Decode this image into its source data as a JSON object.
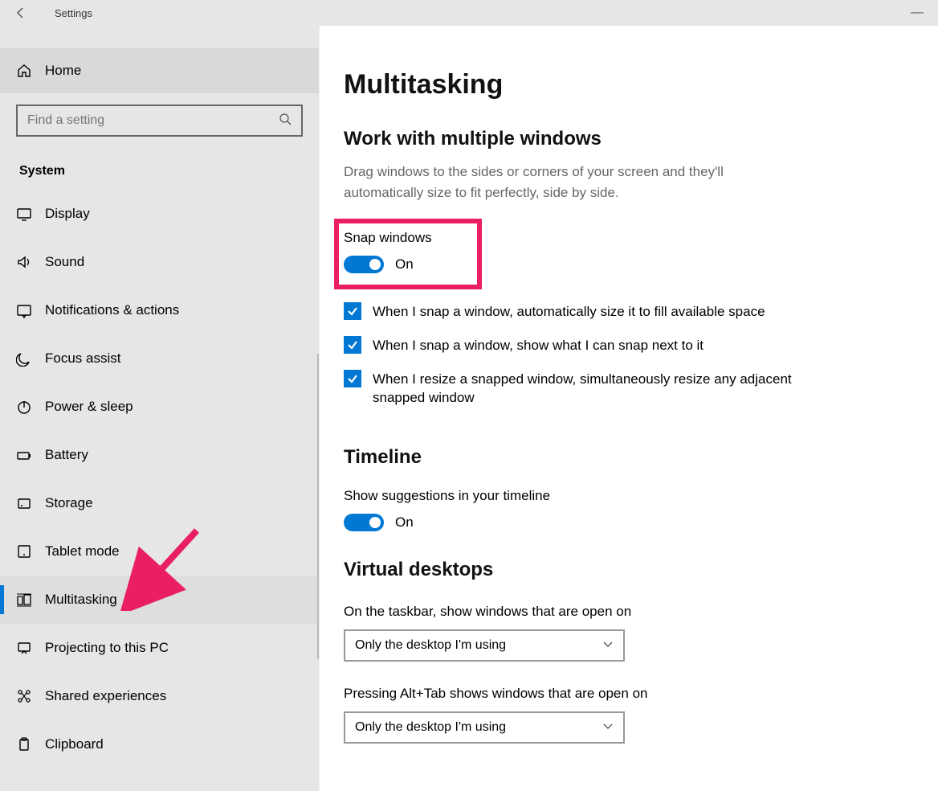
{
  "window": {
    "title": "Settings"
  },
  "sidebar": {
    "home_label": "Home",
    "search_placeholder": "Find a setting",
    "group_label": "System",
    "items": [
      {
        "icon": "display",
        "label": "Display"
      },
      {
        "icon": "sound",
        "label": "Sound"
      },
      {
        "icon": "notifications",
        "label": "Notifications & actions"
      },
      {
        "icon": "focus",
        "label": "Focus assist"
      },
      {
        "icon": "power",
        "label": "Power & sleep"
      },
      {
        "icon": "battery",
        "label": "Battery"
      },
      {
        "icon": "storage",
        "label": "Storage"
      },
      {
        "icon": "tablet",
        "label": "Tablet mode"
      },
      {
        "icon": "multitasking",
        "label": "Multitasking",
        "selected": true
      },
      {
        "icon": "projecting",
        "label": "Projecting to this PC"
      },
      {
        "icon": "shared",
        "label": "Shared experiences"
      },
      {
        "icon": "clipboard",
        "label": "Clipboard"
      }
    ]
  },
  "page": {
    "title": "Multitasking",
    "sections": {
      "snap": {
        "heading": "Work with multiple windows",
        "description": "Drag windows to the sides or corners of your screen and they'll automatically size to fit perfectly, side by side.",
        "toggle_label": "Snap windows",
        "toggle_state": "On",
        "checks": [
          "When I snap a window, automatically size it to fill available space",
          "When I snap a window, show what I can snap next to it",
          "When I resize a snapped window, simultaneously resize any adjacent snapped window"
        ]
      },
      "timeline": {
        "heading": "Timeline",
        "toggle_label": "Show suggestions in your timeline",
        "toggle_state": "On"
      },
      "vdesktops": {
        "heading": "Virtual desktops",
        "dd1_label": "On the taskbar, show windows that are open on",
        "dd1_value": "Only the desktop I'm using",
        "dd2_label": "Pressing Alt+Tab shows windows that are open on",
        "dd2_value": "Only the desktop I'm using"
      }
    }
  },
  "annotations": {
    "highlight_color": "#e91e63",
    "arrow_color": "#e91e63"
  }
}
